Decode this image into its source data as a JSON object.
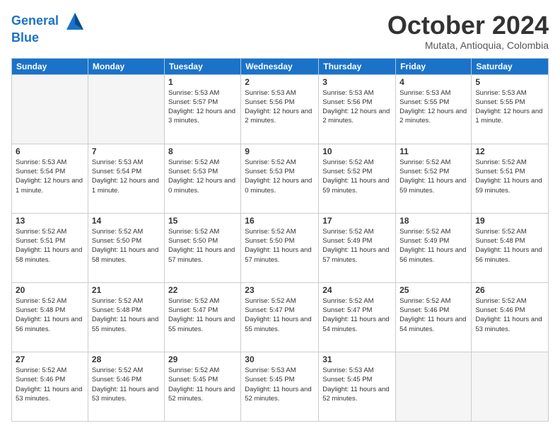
{
  "logo": {
    "line1": "General",
    "line2": "Blue"
  },
  "title": "October 2024",
  "subtitle": "Mutata, Antioquia, Colombia",
  "days_of_week": [
    "Sunday",
    "Monday",
    "Tuesday",
    "Wednesday",
    "Thursday",
    "Friday",
    "Saturday"
  ],
  "weeks": [
    [
      {
        "day": "",
        "info": ""
      },
      {
        "day": "",
        "info": ""
      },
      {
        "day": "1",
        "info": "Sunrise: 5:53 AM\nSunset: 5:57 PM\nDaylight: 12 hours\nand 3 minutes."
      },
      {
        "day": "2",
        "info": "Sunrise: 5:53 AM\nSunset: 5:56 PM\nDaylight: 12 hours\nand 2 minutes."
      },
      {
        "day": "3",
        "info": "Sunrise: 5:53 AM\nSunset: 5:56 PM\nDaylight: 12 hours\nand 2 minutes."
      },
      {
        "day": "4",
        "info": "Sunrise: 5:53 AM\nSunset: 5:55 PM\nDaylight: 12 hours\nand 2 minutes."
      },
      {
        "day": "5",
        "info": "Sunrise: 5:53 AM\nSunset: 5:55 PM\nDaylight: 12 hours\nand 1 minute."
      }
    ],
    [
      {
        "day": "6",
        "info": "Sunrise: 5:53 AM\nSunset: 5:54 PM\nDaylight: 12 hours\nand 1 minute."
      },
      {
        "day": "7",
        "info": "Sunrise: 5:53 AM\nSunset: 5:54 PM\nDaylight: 12 hours\nand 1 minute."
      },
      {
        "day": "8",
        "info": "Sunrise: 5:52 AM\nSunset: 5:53 PM\nDaylight: 12 hours\nand 0 minutes."
      },
      {
        "day": "9",
        "info": "Sunrise: 5:52 AM\nSunset: 5:53 PM\nDaylight: 12 hours\nand 0 minutes."
      },
      {
        "day": "10",
        "info": "Sunrise: 5:52 AM\nSunset: 5:52 PM\nDaylight: 11 hours\nand 59 minutes."
      },
      {
        "day": "11",
        "info": "Sunrise: 5:52 AM\nSunset: 5:52 PM\nDaylight: 11 hours\nand 59 minutes."
      },
      {
        "day": "12",
        "info": "Sunrise: 5:52 AM\nSunset: 5:51 PM\nDaylight: 11 hours\nand 59 minutes."
      }
    ],
    [
      {
        "day": "13",
        "info": "Sunrise: 5:52 AM\nSunset: 5:51 PM\nDaylight: 11 hours\nand 58 minutes."
      },
      {
        "day": "14",
        "info": "Sunrise: 5:52 AM\nSunset: 5:50 PM\nDaylight: 11 hours\nand 58 minutes."
      },
      {
        "day": "15",
        "info": "Sunrise: 5:52 AM\nSunset: 5:50 PM\nDaylight: 11 hours\nand 57 minutes."
      },
      {
        "day": "16",
        "info": "Sunrise: 5:52 AM\nSunset: 5:50 PM\nDaylight: 11 hours\nand 57 minutes."
      },
      {
        "day": "17",
        "info": "Sunrise: 5:52 AM\nSunset: 5:49 PM\nDaylight: 11 hours\nand 57 minutes."
      },
      {
        "day": "18",
        "info": "Sunrise: 5:52 AM\nSunset: 5:49 PM\nDaylight: 11 hours\nand 56 minutes."
      },
      {
        "day": "19",
        "info": "Sunrise: 5:52 AM\nSunset: 5:48 PM\nDaylight: 11 hours\nand 56 minutes."
      }
    ],
    [
      {
        "day": "20",
        "info": "Sunrise: 5:52 AM\nSunset: 5:48 PM\nDaylight: 11 hours\nand 56 minutes."
      },
      {
        "day": "21",
        "info": "Sunrise: 5:52 AM\nSunset: 5:48 PM\nDaylight: 11 hours\nand 55 minutes."
      },
      {
        "day": "22",
        "info": "Sunrise: 5:52 AM\nSunset: 5:47 PM\nDaylight: 11 hours\nand 55 minutes."
      },
      {
        "day": "23",
        "info": "Sunrise: 5:52 AM\nSunset: 5:47 PM\nDaylight: 11 hours\nand 55 minutes."
      },
      {
        "day": "24",
        "info": "Sunrise: 5:52 AM\nSunset: 5:47 PM\nDaylight: 11 hours\nand 54 minutes."
      },
      {
        "day": "25",
        "info": "Sunrise: 5:52 AM\nSunset: 5:46 PM\nDaylight: 11 hours\nand 54 minutes."
      },
      {
        "day": "26",
        "info": "Sunrise: 5:52 AM\nSunset: 5:46 PM\nDaylight: 11 hours\nand 53 minutes."
      }
    ],
    [
      {
        "day": "27",
        "info": "Sunrise: 5:52 AM\nSunset: 5:46 PM\nDaylight: 11 hours\nand 53 minutes."
      },
      {
        "day": "28",
        "info": "Sunrise: 5:52 AM\nSunset: 5:46 PM\nDaylight: 11 hours\nand 53 minutes."
      },
      {
        "day": "29",
        "info": "Sunrise: 5:52 AM\nSunset: 5:45 PM\nDaylight: 11 hours\nand 52 minutes."
      },
      {
        "day": "30",
        "info": "Sunrise: 5:53 AM\nSunset: 5:45 PM\nDaylight: 11 hours\nand 52 minutes."
      },
      {
        "day": "31",
        "info": "Sunrise: 5:53 AM\nSunset: 5:45 PM\nDaylight: 11 hours\nand 52 minutes."
      },
      {
        "day": "",
        "info": ""
      },
      {
        "day": "",
        "info": ""
      }
    ]
  ]
}
